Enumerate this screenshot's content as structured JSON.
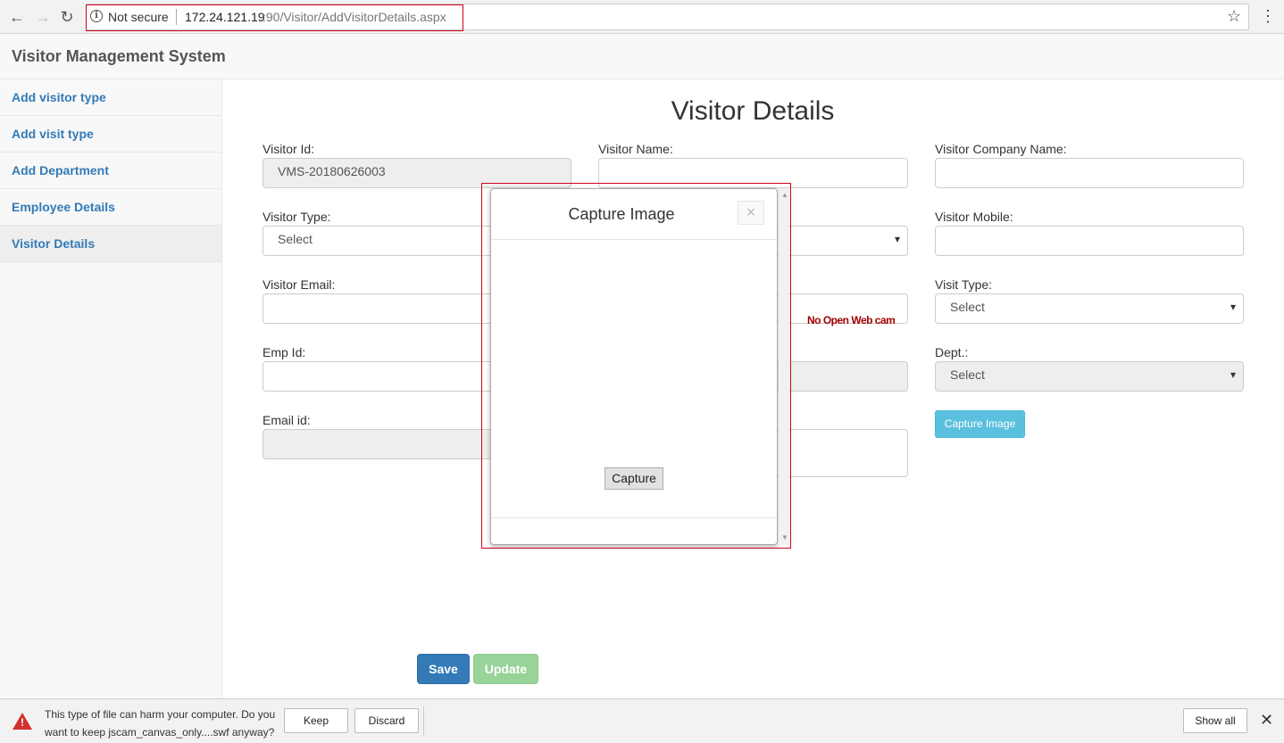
{
  "browser": {
    "not_secure": "Not secure",
    "url_host": "172.24.121.19",
    "url_path": ":90/Visitor/AddVisitorDetails.aspx"
  },
  "app": {
    "brand": "Visitor Management System"
  },
  "sidebar": {
    "items": [
      {
        "label": "Add visitor type"
      },
      {
        "label": "Add visit type"
      },
      {
        "label": "Add Department"
      },
      {
        "label": "Employee Details"
      },
      {
        "label": "Visitor Details"
      }
    ]
  },
  "form": {
    "title": "Visitor Details",
    "visitor_id": {
      "label": "Visitor Id:",
      "value": "VMS-20180626003"
    },
    "visitor_name": {
      "label": "Visitor Name:",
      "value": ""
    },
    "visitor_company": {
      "label": "Visitor Company Name:",
      "value": ""
    },
    "visitor_type": {
      "label": "Visitor Type:",
      "value": "Select"
    },
    "visitor_mobile": {
      "label": "Visitor Mobile:",
      "value": ""
    },
    "visitor_email": {
      "label": "Visitor Email:",
      "value": ""
    },
    "visit_type": {
      "label": "Visit Type:",
      "value": "Select"
    },
    "emp_id": {
      "label": "Emp Id:",
      "value": ""
    },
    "dept": {
      "label": "Dept.:",
      "value": "Select"
    },
    "email_id": {
      "label": "Email id:",
      "value": ""
    },
    "no_webcam": "No Open Web cam",
    "capture_image_button": "Capture Image",
    "save_button": "Save",
    "update_button": "Update"
  },
  "modal": {
    "title": "Capture Image",
    "close": "×",
    "capture_button": "Capture"
  },
  "download_bar": {
    "warning": "This type of file can harm your computer. Do you want to keep jscam_canvas_only....swf anyway?",
    "keep": "Keep",
    "discard": "Discard",
    "show_all": "Show all"
  }
}
